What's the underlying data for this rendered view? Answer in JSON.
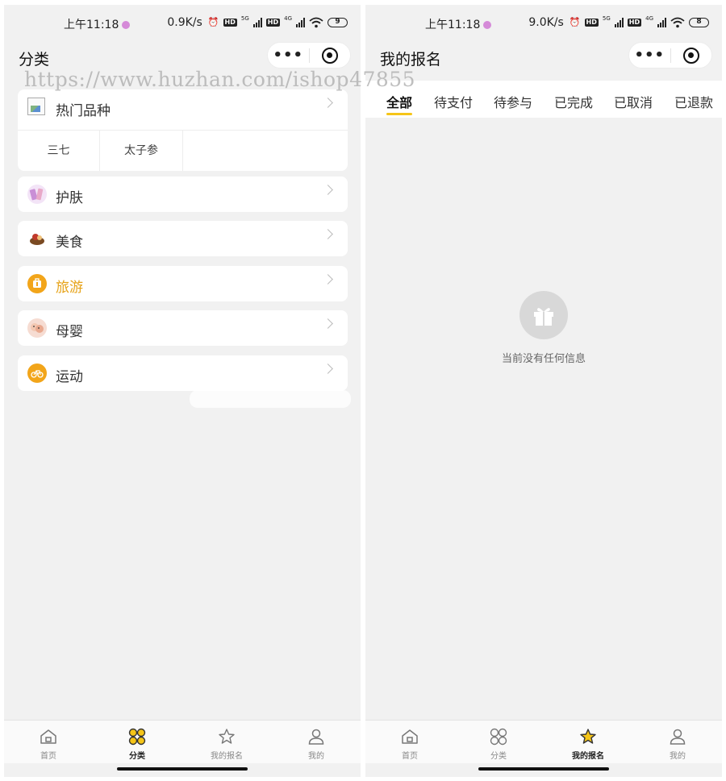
{
  "watermark": "https://www.huzhan.com/ishop47855",
  "left_screen": {
    "status": {
      "time": "上午11:18",
      "speed": "0.9K/s",
      "network_5g": "5G",
      "network_4g": "4G",
      "battery": "9"
    },
    "nav_title": "分类",
    "hot_category": {
      "label": "热门品种",
      "sub_items": [
        "三七",
        "太子参"
      ]
    },
    "categories": [
      {
        "label": "护肤",
        "icon": "skincare-icon",
        "color": "#c98fd6"
      },
      {
        "label": "美食",
        "icon": "food-icon",
        "color": "#8b5a2b"
      },
      {
        "label": "旅游",
        "icon": "travel-icon",
        "color": "#f2a51a"
      },
      {
        "label": "母婴",
        "icon": "baby-icon",
        "color": "#e8b8a8"
      },
      {
        "label": "运动",
        "icon": "bicycle-icon",
        "color": "#f2a51a"
      }
    ],
    "highlight_color": "#e6a217",
    "tabbar": [
      {
        "label": "首页",
        "icon": "home-icon"
      },
      {
        "label": "分类",
        "icon": "category-icon"
      },
      {
        "label": "我的报名",
        "icon": "star-icon"
      },
      {
        "label": "我的",
        "icon": "user-icon"
      }
    ],
    "active_tab": "分类"
  },
  "right_screen": {
    "status": {
      "time": "上午11:18",
      "speed": "9.0K/s",
      "network_5g": "5G",
      "network_4g": "4G",
      "battery": "8"
    },
    "nav_title": "我的报名",
    "filter_tabs": [
      "全部",
      "待支付",
      "待参与",
      "已完成",
      "已取消",
      "已退款"
    ],
    "active_filter": "全部",
    "empty_message": "当前没有任何信息",
    "tabbar": [
      {
        "label": "首页",
        "icon": "home-icon"
      },
      {
        "label": "分类",
        "icon": "category-icon"
      },
      {
        "label": "我的报名",
        "icon": "star-icon"
      },
      {
        "label": "我的",
        "icon": "user-icon"
      }
    ],
    "active_tab": "我的报名",
    "accent_color": "#f5c518"
  }
}
